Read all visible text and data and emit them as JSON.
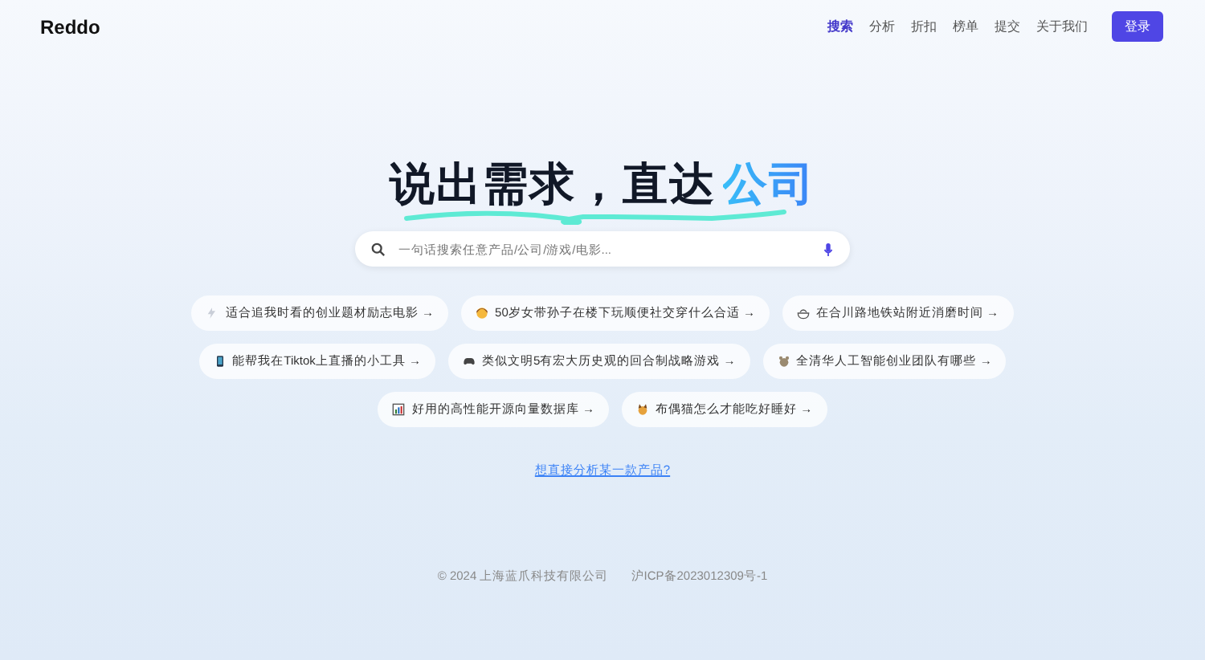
{
  "header": {
    "logo": "Reddo",
    "nav": [
      {
        "label": "搜索",
        "selected": true
      },
      {
        "label": "分析",
        "selected": false
      },
      {
        "label": "折扣",
        "selected": false
      },
      {
        "label": "榜单",
        "selected": false
      },
      {
        "label": "提交",
        "selected": false
      },
      {
        "label": "关于我们",
        "selected": false
      }
    ],
    "login": "登录"
  },
  "hero": {
    "title": "说出需求，直达",
    "highlight": "公司"
  },
  "search": {
    "placeholder": "一句话搜索任意产品/公司/游戏/电影..."
  },
  "suggestion_rows": [
    [
      {
        "kind": "bolt",
        "label": "适合追我时看的创业题材励志电影 →"
      },
      {
        "kind": "face",
        "label": "50岁女带孙子在楼下玩顺便社交穿什么合适 →"
      },
      {
        "kind": "bowl",
        "label": "在合川路地铁站附近消磨时间 →"
      }
    ],
    [
      {
        "kind": "phone",
        "label": "能帮我在Tiktok上直播的小工具 →"
      },
      {
        "kind": "gamepad",
        "label": "类似文明5有宏大历史观的回合制战略游戏 →"
      },
      {
        "kind": "animal",
        "label": "全清华人工智能创业团队有哪些 →"
      }
    ],
    [
      {
        "kind": "chart",
        "label": "好用的高性能开源向量数据库 →"
      },
      {
        "kind": "cat",
        "label": "布偶猫怎么才能吃好睡好 →"
      }
    ]
  ],
  "link": "想直接分析某一款产品?",
  "footer": {
    "copyright": "© 2024 上海蓝爪科技有限公司",
    "icp": "沪ICP备2023012309号-1"
  }
}
